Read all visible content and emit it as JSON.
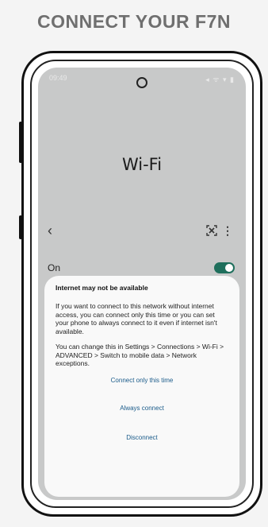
{
  "header": {
    "title": "CONNECT YOUR F7N"
  },
  "status_bar": {
    "time": "09:49",
    "icons": "◂ ᯤ ▾ ▮"
  },
  "wifi_screen": {
    "heading": "Wi-Fi",
    "back_icon": "chevron-left-icon",
    "scan_icon": "qr-scan-icon",
    "more_icon": "more-vert-icon",
    "on_label": "On",
    "toggle_on": true,
    "accent_color": "#1f6f5c"
  },
  "dialog": {
    "title": "Internet may not be available",
    "body_1": "If you want to connect to this network without internet access, you can connect only this time or you can set your phone to always connect to it even if internet isn't available.",
    "body_2": "You can change this in Settings > Connections > Wi-Fi > ADVANCED > Switch to mobile data > Network exceptions.",
    "action_once": "Connect only this time",
    "action_always": "Always connect",
    "action_disconnect": "Disconnect",
    "action_color": "#1a5b8a"
  }
}
